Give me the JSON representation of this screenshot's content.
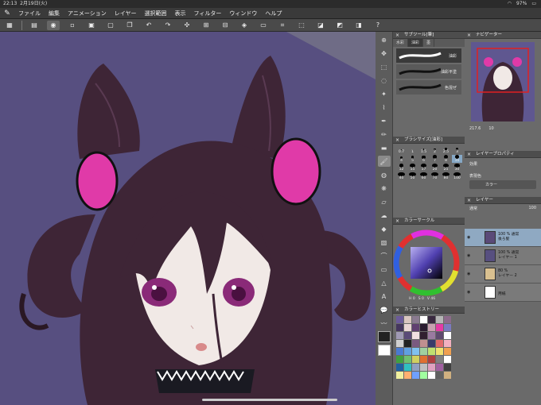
{
  "status": {
    "time": "22:13",
    "date": "2月19日(火)",
    "battery": "97%"
  },
  "menu": [
    "ファイル",
    "編集",
    "アニメーション",
    "レイヤー",
    "選択範囲",
    "表示",
    "フィルター",
    "ウィンドウ",
    "ヘルプ"
  ],
  "panels": {
    "subtool": {
      "title": "サブツール[筆]",
      "tabs": [
        "水彩",
        "油彩",
        "墨"
      ],
      "items": [
        "油彩",
        "油彩平塗",
        "色混ぜ"
      ]
    },
    "brushsize": {
      "title": "ブラシサイズ[油彩]",
      "sizes": [
        "0.7",
        "1",
        "1.5",
        "2",
        "2.5",
        "3",
        "4",
        "5",
        "6",
        "7",
        "8",
        "10",
        "12",
        "15",
        "17",
        "20",
        "25",
        "30",
        "40",
        "50",
        "60",
        "70",
        "80",
        "100"
      ]
    },
    "colorcircle": {
      "title": "カラーサークル",
      "values": [
        "H 0",
        "S 0",
        "V 46"
      ]
    },
    "history": {
      "title": "カラーヒストリー"
    },
    "navigator": {
      "title": "ナビゲーター",
      "zoom": "217.6",
      "angle": "10"
    },
    "layerprop": {
      "title": "レイヤープロパティ",
      "effect": "効果",
      "expression": "表現色",
      "expression_value": "カラー"
    },
    "layers": {
      "title": "レイヤー",
      "blend": "通常",
      "opacity": "100",
      "rows": [
        {
          "line1": "100 % 通常",
          "line2": "後ろ髪"
        },
        {
          "line1": "100 % 通常",
          "line2": "レイヤー 1"
        },
        {
          "line1": "80 %",
          "line2": "レイヤー 2"
        },
        {
          "line1": "",
          "line2": "用紙"
        }
      ]
    }
  },
  "colors": {
    "canvas_bg": "#574f80",
    "hair": "#3e2536",
    "ornament": "#e03aa8",
    "skin": "#f1e9e6",
    "eye": "#8a2a78"
  },
  "history_colors": [
    "#6b5a9a",
    "#d9c6c0",
    "#8a7a8f",
    "#ffffff",
    "#3a2a40",
    "#b5b5b5",
    "#8c6a8a",
    "#44355e",
    "#e9d5d5",
    "#604070",
    "#2a1c30",
    "#c8a0b0",
    "#e53aa5",
    "#7b7bc0",
    "#a09ab5",
    "#5a4a78",
    "#f0e0e0",
    "#302030",
    "#9a7aa0",
    "#604a6e",
    "#ffffff",
    "#d0d0d0",
    "#222222",
    "#7a5a80",
    "#c09090",
    "#3a3a6a",
    "#e06a6a",
    "#f2b0c0",
    "#4a7ad0",
    "#60a0e0",
    "#80c0f0",
    "#a0d0a0",
    "#c0e070",
    "#f0e070",
    "#f0a050",
    "#40a040",
    "#70c070",
    "#d0d060",
    "#e07030",
    "#b04040",
    "#808080",
    "#ffffff",
    "#2060a0",
    "#30c0c0",
    "#90a0c0",
    "#c0c0c0",
    "#e0a0c0",
    "#a060a0",
    "#404040",
    "#f0f0a0",
    "#ffb070",
    "#70a0ff",
    "#a0ffa0",
    "#ffffff",
    "#606060",
    "#d0b080"
  ]
}
